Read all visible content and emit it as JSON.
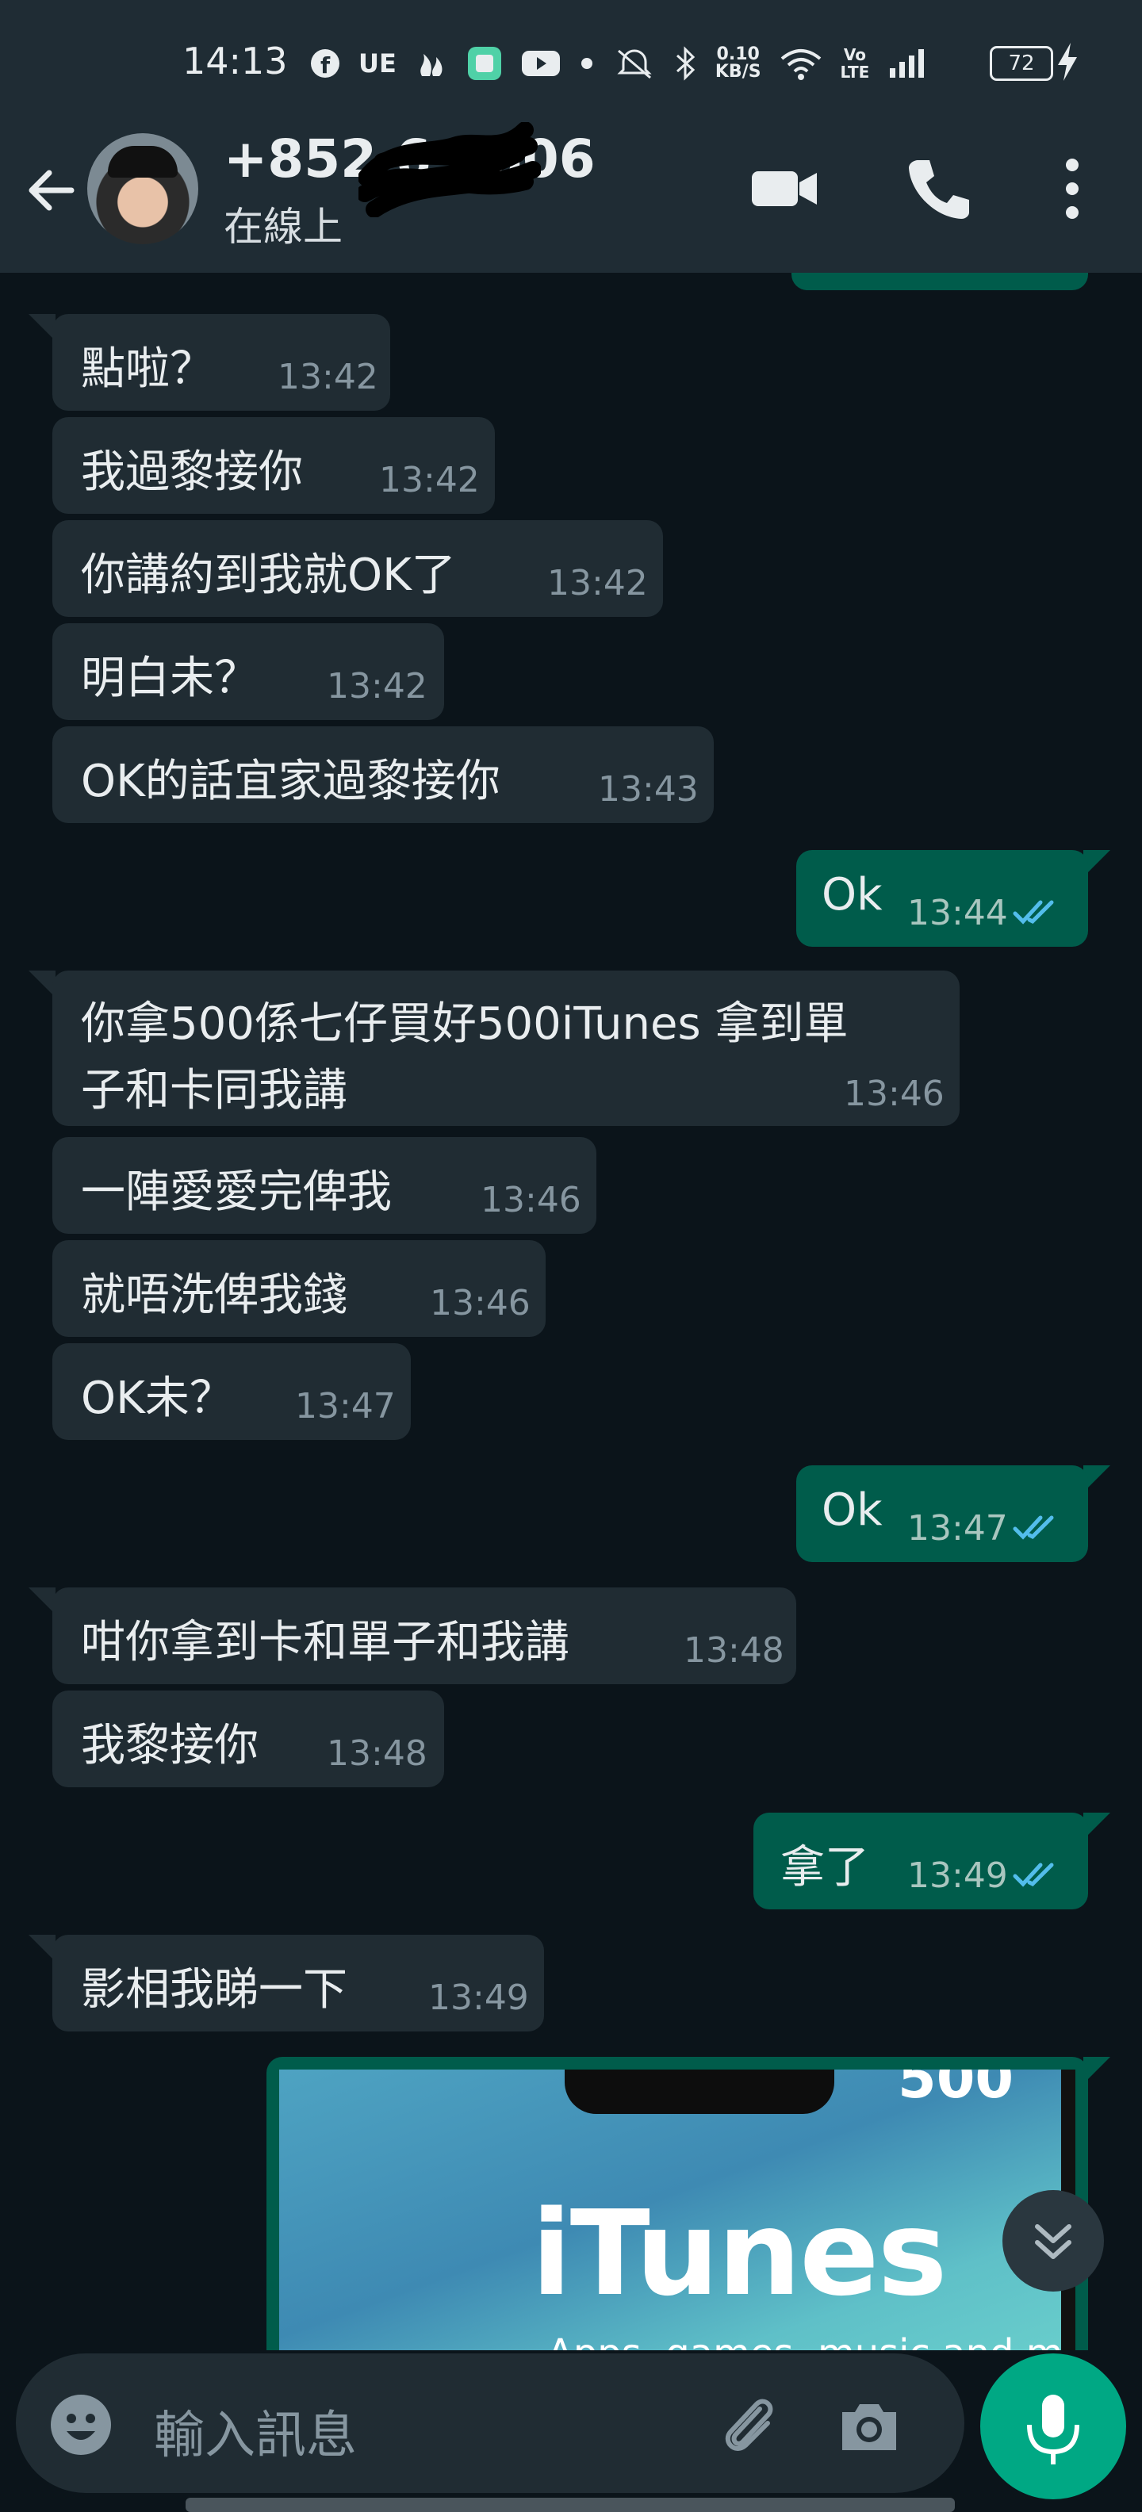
{
  "status_bar": {
    "time": "14:13",
    "net_speed": "0.10\nKB/S",
    "volte": "Vo\nLTE",
    "battery": "72",
    "icons": [
      "facebook-icon",
      "ue-text-icon",
      "app-icon",
      "green-app-icon",
      "youtube-icon",
      "dot-icon",
      "mute-icon",
      "bluetooth-icon",
      "wifi-icon",
      "volte-icon",
      "signal-icon",
      "battery-icon",
      "charging-icon"
    ]
  },
  "header": {
    "contact_name": "+852 6   9606",
    "status": "在線上"
  },
  "messages": [
    {
      "dir": "in",
      "text": "點啦？",
      "time": "13:42"
    },
    {
      "dir": "in",
      "text": "我過黎接你",
      "time": "13:42"
    },
    {
      "dir": "in",
      "text": "你講約到我就OK了",
      "time": "13:42"
    },
    {
      "dir": "in",
      "text": "明白未？",
      "time": "13:42"
    },
    {
      "dir": "in",
      "text": "OK的話宜家過黎接你",
      "time": "13:43"
    },
    {
      "dir": "out",
      "text": "Ok",
      "time": "13:44"
    },
    {
      "dir": "in",
      "text": "你拿500係七仔買好500iTunes  拿到單",
      "text2": "子和卡同我講",
      "time": "13:46"
    },
    {
      "dir": "in",
      "text": "一陣愛愛完俾我",
      "time": "13:46"
    },
    {
      "dir": "in",
      "text": "就唔洗俾我錢",
      "time": "13:46"
    },
    {
      "dir": "in",
      "text": "OK未？",
      "time": "13:47"
    },
    {
      "dir": "out",
      "text": "Ok",
      "time": "13:47"
    },
    {
      "dir": "in",
      "text": "咁你拿到卡和單子和我講",
      "time": "13:48"
    },
    {
      "dir": "in",
      "text": "我黎接你",
      "time": "13:48"
    },
    {
      "dir": "out",
      "text": "拿了",
      "time": "13:49"
    },
    {
      "dir": "in",
      "text": "影相我睇一下",
      "time": "13:49"
    }
  ],
  "image_message": {
    "brand": "iTunes",
    "amount": "500",
    "subtitle": "Apps, games, music and more"
  },
  "composer": {
    "placeholder": "輸入訊息"
  },
  "colors": {
    "background": "#0b141a",
    "header": "#1f2c34",
    "incoming_bubble": "#202c33",
    "outgoing_bubble": "#005c4b",
    "accent": "#00a884",
    "read_tick": "#53bdeb"
  }
}
